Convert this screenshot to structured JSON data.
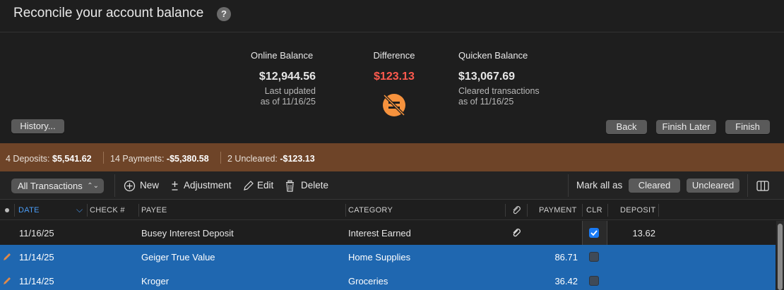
{
  "window": {
    "title": "Reconcile your account balance",
    "help": "?"
  },
  "balances": {
    "online": {
      "label": "Online Balance",
      "amount": "$12,944.56",
      "sub1": "Last updated",
      "sub2": "as of 11/16/25"
    },
    "difference": {
      "label": "Difference",
      "amount": "$123.13",
      "icon": "not-equal-icon",
      "color": "#ff5a4e"
    },
    "quicken": {
      "label": "Quicken Balance",
      "amount": "$13,067.69",
      "sub1": "Cleared transactions",
      "sub2": "as of 11/16/25"
    }
  },
  "buttons": {
    "history": "History...",
    "back": "Back",
    "finish_later": "Finish Later",
    "finish": "Finish"
  },
  "status": {
    "deposits_label": "4 Deposits: ",
    "deposits_value": "$5,541.62",
    "payments_label": "14 Payments: ",
    "payments_value": "-$5,380.58",
    "uncleared_label": "2 Uncleared: ",
    "uncleared_value": "-$123.13",
    "bg_color": "#6e4428"
  },
  "toolbar": {
    "filter": "All Transactions",
    "new": "New",
    "adjustment": "Adjustment",
    "edit": "Edit",
    "delete": "Delete",
    "mark_all": "Mark all as",
    "cleared": "Cleared",
    "uncleared": "Uncleared"
  },
  "columns": {
    "date": "DATE",
    "check": "CHECK #",
    "payee": "PAYEE",
    "category": "CATEGORY",
    "payment": "PAYMENT",
    "clr": "CLR",
    "deposit": "DEPOSIT"
  },
  "rows": [
    {
      "date": "11/16/25",
      "payee": "Busey Interest Deposit",
      "category": "Interest Earned",
      "payment": "",
      "cleared": true,
      "deposit": "13.62",
      "attachment": true,
      "selected": false
    },
    {
      "date": "11/14/25",
      "payee": "Geiger True Value",
      "category": "Home Supplies",
      "payment": "86.71",
      "cleared": false,
      "deposit": "",
      "attachment": false,
      "selected": true
    },
    {
      "date": "11/14/25",
      "payee": "Kroger",
      "category": "Groceries",
      "payment": "36.42",
      "cleared": false,
      "deposit": "",
      "attachment": false,
      "selected": true
    }
  ],
  "colors": {
    "selected_row": "#1f67b0",
    "accent": "#4a9cf5"
  }
}
